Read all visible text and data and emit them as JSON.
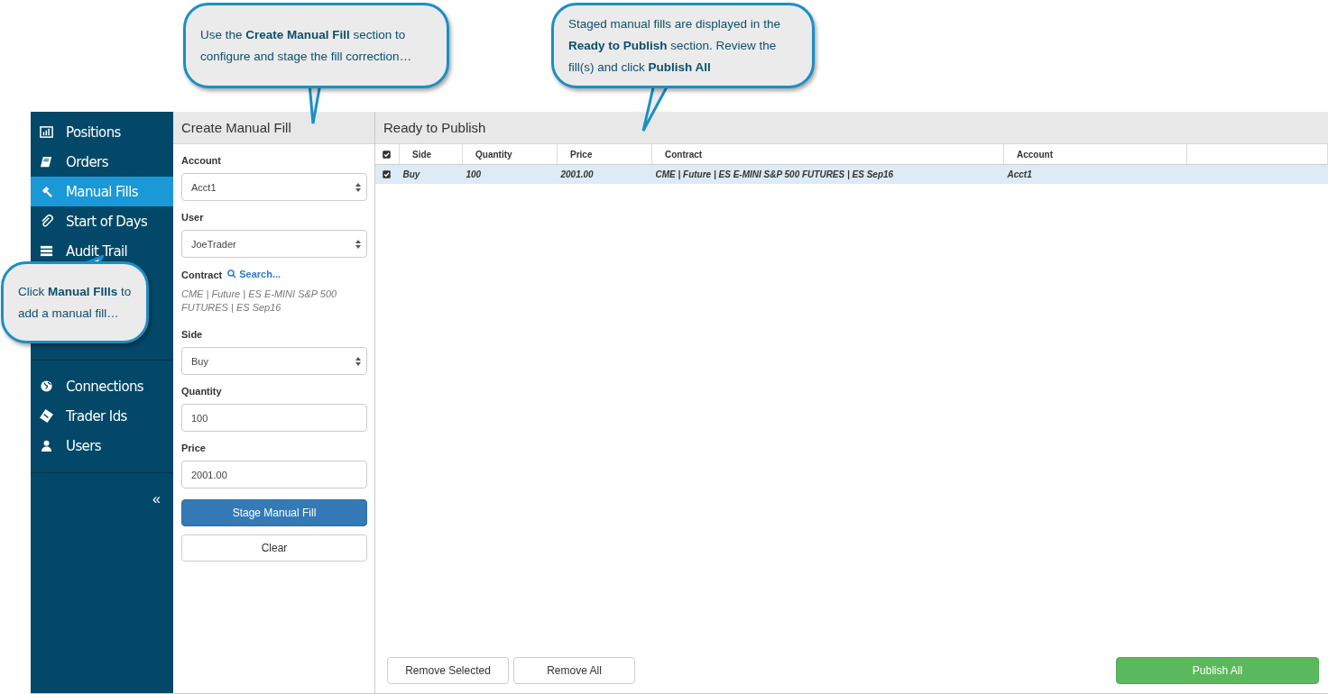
{
  "callouts": [
    {
      "text": "Use the **Create Manual Fill** section to configure and stage the fill correction…"
    },
    {
      "text": "Staged manual fills are displayed in the **Ready to Publish** section. Review the fill(s) and click **Publish All**"
    },
    {
      "text": "Click **Manual FIlls** to add a manual fill…"
    }
  ],
  "sidebar": {
    "groups": [
      {
        "items": [
          {
            "label": "Positions",
            "selected": false
          },
          {
            "label": "Orders",
            "selected": false
          },
          {
            "label": "Manual Fills",
            "selected": true
          },
          {
            "label": "Start of Days",
            "selected": false
          },
          {
            "label": "Audit Trail",
            "selected": false
          }
        ]
      },
      {
        "items": [
          {
            "label": "Connections",
            "selected": false
          },
          {
            "label": "Trader Ids",
            "selected": false
          },
          {
            "label": "Users",
            "selected": false
          }
        ]
      }
    ],
    "collapse": "«"
  },
  "create_panel": {
    "title": "Create Manual Fill",
    "fields": [
      {
        "kind": "select",
        "label": "Account",
        "value": "Acct1"
      },
      {
        "kind": "select",
        "label": "User",
        "value": "JoeTrader"
      },
      {
        "kind": "contract",
        "label": "Contract",
        "link": "Search...",
        "value": "CME | Future | ES E-MINI S&P 500 FUTURES | ES Sep16"
      },
      {
        "kind": "select",
        "label": "Side",
        "value": "Buy"
      },
      {
        "kind": "input",
        "label": "Quantity",
        "value": "100"
      },
      {
        "kind": "input",
        "label": "Price",
        "value": "2001.00"
      }
    ],
    "buttons": [
      {
        "label": "Stage Manual Fill",
        "kind": "primary"
      },
      {
        "label": "Clear",
        "kind": "default"
      }
    ]
  },
  "ready_panel": {
    "title": "Ready to Publish",
    "table": {
      "all_checked": true,
      "columns": [
        "Side",
        "Quantity",
        "Price",
        "Contract",
        "Account"
      ],
      "rows": [
        {
          "checked": true,
          "selected": true,
          "cells": [
            "Buy",
            "100",
            "2001.00",
            "CME | Future | ES E-MINI S&P 500 FUTURES | ES Sep16",
            "Acct1"
          ]
        }
      ]
    },
    "buttons": [
      {
        "label": "Remove Selected",
        "kind": "default"
      },
      {
        "label": "Remove All",
        "kind": "default"
      },
      {
        "label": "Publish All",
        "kind": "success"
      }
    ]
  }
}
